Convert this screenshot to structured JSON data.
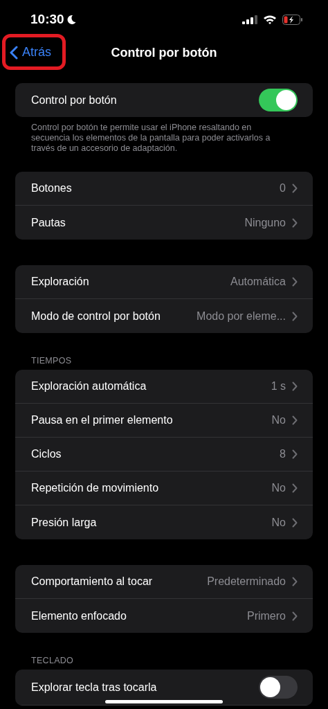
{
  "status_bar": {
    "time": "10:30",
    "focus_moon": true,
    "battery_charging": true
  },
  "nav": {
    "back": {
      "label": "Atrás",
      "highlighted": true
    },
    "title": "Control por botón"
  },
  "sections": [
    {
      "rows": [
        {
          "kind": "toggle",
          "label": "Control por botón",
          "on": true
        }
      ],
      "footer": "Control por botón te permite usar el iPhone resaltando en secuencia los elementos de la pantalla para poder activarlos a través de un accesorio de adaptación."
    },
    {
      "rows": [
        {
          "kind": "link",
          "label": "Botones",
          "value": "0"
        },
        {
          "kind": "link",
          "label": "Pautas",
          "value": "Ninguno"
        }
      ]
    },
    {
      "rows": [
        {
          "kind": "link",
          "label": "Exploración",
          "value": "Automática"
        },
        {
          "kind": "link",
          "label": "Modo de control por botón",
          "value": "Modo por eleme..."
        }
      ]
    },
    {
      "header": "TIEMPOS",
      "rows": [
        {
          "kind": "link",
          "label": "Exploración automática",
          "value": "1 s"
        },
        {
          "kind": "link",
          "label": "Pausa en el primer elemento",
          "value": "No"
        },
        {
          "kind": "link",
          "label": "Ciclos",
          "value": "8"
        },
        {
          "kind": "link",
          "label": "Repetición de movimiento",
          "value": "No"
        },
        {
          "kind": "link",
          "label": "Presión larga",
          "value": "No"
        }
      ]
    },
    {
      "rows": [
        {
          "kind": "link",
          "label": "Comportamiento al tocar",
          "value": "Predeterminado"
        },
        {
          "kind": "link",
          "label": "Elemento enfocado",
          "value": "Primero"
        }
      ]
    },
    {
      "header": "TECLADO",
      "rows": [
        {
          "kind": "toggle",
          "label": "Explorar tecla tras tocarla",
          "on": false
        }
      ]
    }
  ]
}
